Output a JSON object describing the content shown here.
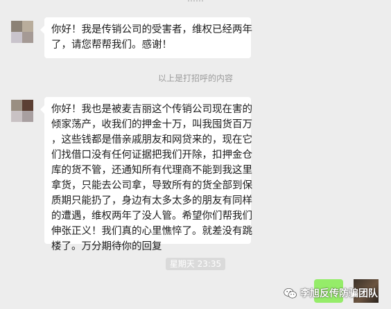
{
  "chat": {
    "clipped_top_text": "……"
  },
  "messages": [
    {
      "lines": [
        "你好！我是传销公司的受害者，维权已经两年",
        "了，请您帮帮我们。感谢！"
      ]
    },
    {
      "lines": [
        "你好！我也是被麦吉丽这个传销公司现在害的",
        "倾家荡产，收我们的押金十万，叫我囤货百万",
        "，这些钱都是借亲戚朋友和网贷来的，现在它",
        "们找借口没有任何证据把我们开除，扣押金仓",
        "库的货不管，还通知所有代理商不能到我这里",
        "拿货，只能去公司拿，导致所有的货全部到保",
        "质期只能扔了，身边有太多太多的朋友有同样",
        "的遭遇，维权两年了没人管。希望你们帮我们",
        "伸张正义！我们真的心里憔悴了。就差没有跳",
        "楼了。万分期待你的回复"
      ]
    }
  ],
  "system_note": "以上是打招呼的内容",
  "timestamp": "星期天 23:35",
  "watermark": {
    "text": "李旭反传防骗团队",
    "icon": "wechat-icon"
  },
  "colors": {
    "background": "#ededed",
    "bubble": "#ffffff",
    "sent_bubble": "#95ec69",
    "meta_text": "#9b9b9b"
  }
}
